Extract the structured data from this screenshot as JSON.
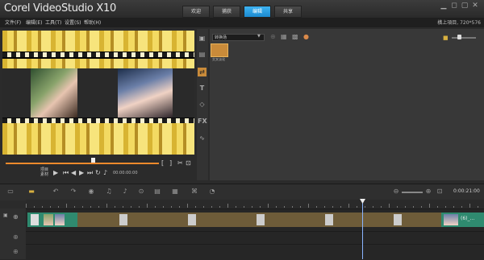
{
  "app": {
    "title": "Corel VideoStudio X10",
    "project_properties": "橫上項目, 720*576"
  },
  "menu": [
    "文件(F)",
    "编辑(E)",
    "工具(T)",
    "设置(S)",
    "帮助(H)"
  ],
  "tabs": [
    {
      "label": "欢迎",
      "active": false
    },
    {
      "label": "捕获",
      "active": false
    },
    {
      "label": "编辑",
      "active": true
    },
    {
      "label": "共享",
      "active": false
    }
  ],
  "player": {
    "mode_project": "项目",
    "mode_clip": "素材",
    "timecode": "00:00:00:00",
    "playhead_position": 0.57
  },
  "library": {
    "filter": "转换场",
    "item_label": "交叉淡化"
  },
  "timeline": {
    "total_time": "0:00:21:00",
    "playhead_position": 0.73,
    "clips": [
      {
        "label": ""
      },
      {
        "label": "(6)_..."
      }
    ]
  },
  "colors": {
    "accent": "#1b8ad0",
    "clip": "#6e5c39",
    "playhead": "#8ab4ff"
  }
}
